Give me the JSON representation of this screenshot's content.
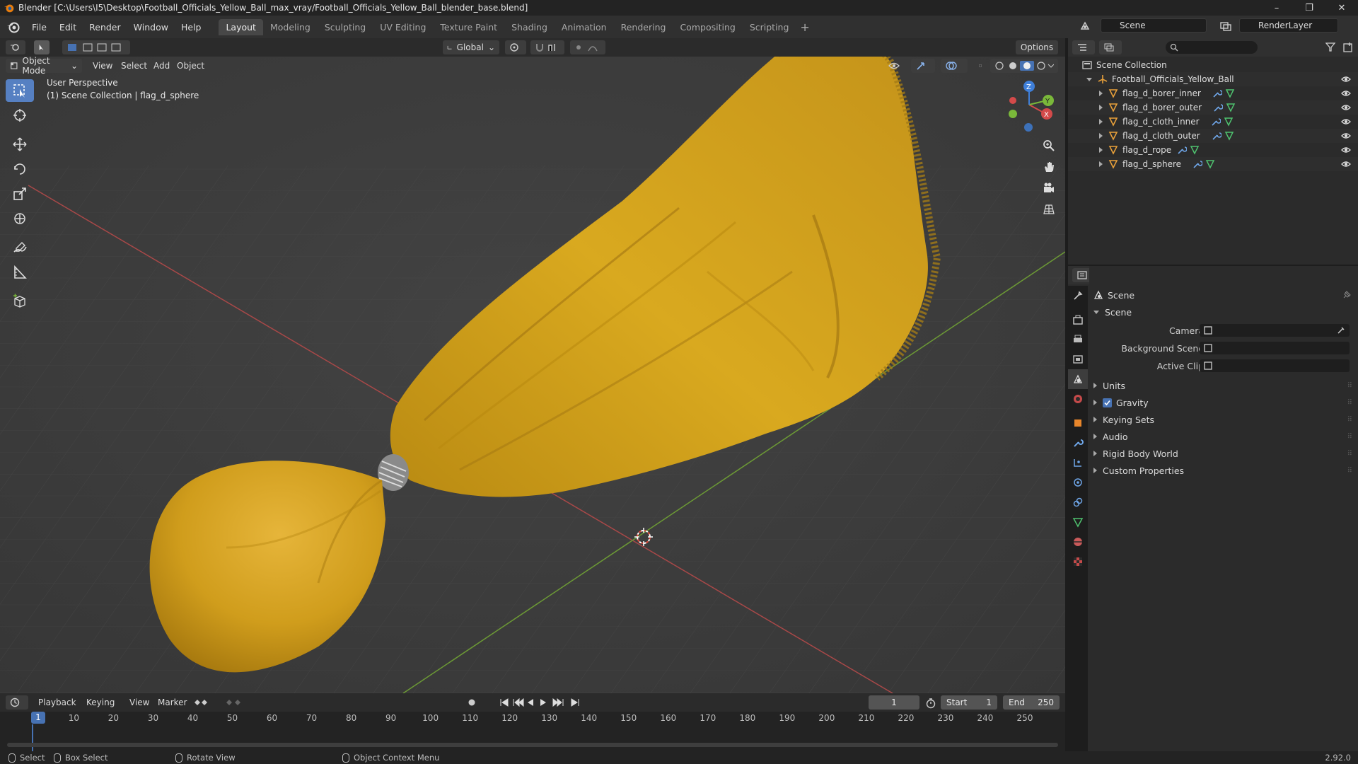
{
  "window": {
    "title": "Blender [C:\\Users\\I5\\Desktop\\Football_Officials_Yellow_Ball_max_vray/Football_Officials_Yellow_Ball_blender_base.blend]",
    "controls": [
      "–",
      "❐",
      "✕"
    ]
  },
  "menu": {
    "items": [
      "File",
      "Edit",
      "Render",
      "Window",
      "Help"
    ],
    "workspaces": [
      "Layout",
      "Modeling",
      "Sculpting",
      "UV Editing",
      "Texture Paint",
      "Shading",
      "Animation",
      "Rendering",
      "Compositing",
      "Scripting"
    ],
    "active_workspace": "Layout",
    "scene": "Scene",
    "view_layer": "RenderLayer"
  },
  "viewport": {
    "transform_orientation": "Global",
    "options_label": "Options",
    "mode": "Object Mode",
    "menus": [
      "View",
      "Select",
      "Add",
      "Object"
    ],
    "info_line1": "User Perspective",
    "info_line2": "(1) Scene Collection | flag_d_sphere",
    "gizmo_axes": [
      "X",
      "Y",
      "Z"
    ]
  },
  "outliner": {
    "root": "Scene Collection",
    "collection": "Football_Officials_Yellow_Ball",
    "objects": [
      "flag_d_borer_inner",
      "flag_d_borer_outer",
      "flag_d_cloth_inner",
      "flag_d_cloth_outer",
      "flag_d_rope",
      "flag_d_sphere"
    ]
  },
  "properties": {
    "context": "Scene",
    "panel": "Scene",
    "fields": [
      {
        "label": "Camera"
      },
      {
        "label": "Background Scene"
      },
      {
        "label": "Active Clip"
      }
    ],
    "subpanels": [
      "Units",
      "Gravity",
      "Keying Sets",
      "Audio",
      "Rigid Body World",
      "Custom Properties"
    ],
    "gravity_checked": true
  },
  "timeline": {
    "menus": [
      "Playback",
      "Keying",
      "View",
      "Marker"
    ],
    "current_frame": "1",
    "start_label": "Start",
    "start": "1",
    "end_label": "End",
    "end": "250",
    "ticks": [
      "1",
      "10",
      "20",
      "30",
      "40",
      "50",
      "60",
      "70",
      "80",
      "90",
      "100",
      "110",
      "120",
      "130",
      "140",
      "150",
      "160",
      "170",
      "180",
      "190",
      "200",
      "210",
      "220",
      "230",
      "240",
      "250"
    ]
  },
  "statusbar": {
    "select": "Select",
    "box_select": "Box Select",
    "rotate": "Rotate View",
    "context_menu": "Object Context Menu",
    "version": "2.92.0"
  },
  "colors": {
    "accent": "#4772b3",
    "flag_yellow": "#d4a418",
    "x_axis": "#d44a4a",
    "y_axis": "#7ab83a",
    "z_axis": "#3f7fd9"
  }
}
